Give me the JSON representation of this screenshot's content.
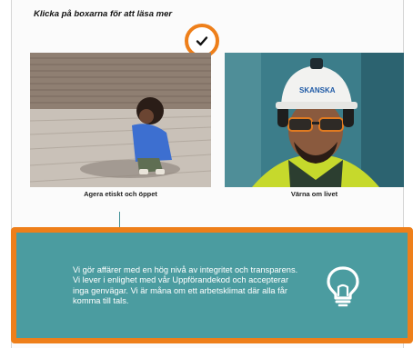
{
  "instruction": "Klicka på boxarna för att läsa mer",
  "check_icon": "checkmark-icon",
  "cards": [
    {
      "caption": "Agera etiskt och öppet",
      "image": "child-sitting-on-deck-photo"
    },
    {
      "caption": "Värna om livet",
      "image": "worker-with-hardhat-photo"
    }
  ],
  "hardhat_text": "SKANSKA",
  "panel": {
    "text": "Vi gör affärer med en hög nivå av integritet och transparens. Vi lever i enlighet med vår Uppförandekod och accepterar inga genvägar. Vi är måna om ett arbetsklimat där alla får komma till tals.",
    "icon": "lightbulb-icon"
  },
  "colors": {
    "accent_orange": "#ee7f1a",
    "panel_teal": "#4b9ca0"
  }
}
